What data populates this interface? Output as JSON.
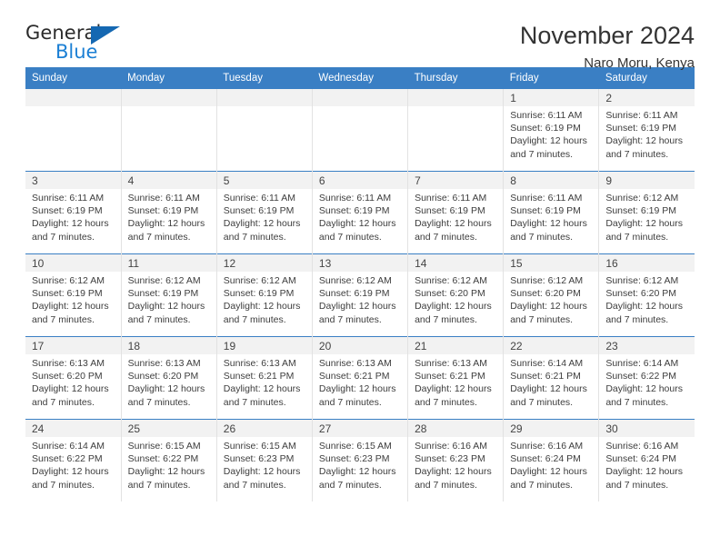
{
  "brand": {
    "name_part1": "General",
    "name_part2": "Blue",
    "accent_color": "#1b7fd4",
    "triangle_color": "#1568b2"
  },
  "header": {
    "title": "November 2024",
    "subtitle": "Naro Moru, Kenya"
  },
  "calendar": {
    "header_bg": "#3a7fc4",
    "daynum_bg": "#f2f2f2",
    "weekday_headers": [
      "Sunday",
      "Monday",
      "Tuesday",
      "Wednesday",
      "Thursday",
      "Friday",
      "Saturday"
    ],
    "labels": {
      "sunrise_prefix": "Sunrise:",
      "sunset_prefix": "Sunset:",
      "daylight_prefix": "Daylight:"
    },
    "weeks": [
      [
        {
          "day": "",
          "sunrise": "",
          "sunset": "",
          "daylight_line1": "",
          "daylight_line2": ""
        },
        {
          "day": "",
          "sunrise": "",
          "sunset": "",
          "daylight_line1": "",
          "daylight_line2": ""
        },
        {
          "day": "",
          "sunrise": "",
          "sunset": "",
          "daylight_line1": "",
          "daylight_line2": ""
        },
        {
          "day": "",
          "sunrise": "",
          "sunset": "",
          "daylight_line1": "",
          "daylight_line2": ""
        },
        {
          "day": "",
          "sunrise": "",
          "sunset": "",
          "daylight_line1": "",
          "daylight_line2": ""
        },
        {
          "day": "1",
          "sunrise": "Sunrise: 6:11 AM",
          "sunset": "Sunset: 6:19 PM",
          "daylight_line1": "Daylight: 12 hours",
          "daylight_line2": "and 7 minutes."
        },
        {
          "day": "2",
          "sunrise": "Sunrise: 6:11 AM",
          "sunset": "Sunset: 6:19 PM",
          "daylight_line1": "Daylight: 12 hours",
          "daylight_line2": "and 7 minutes."
        }
      ],
      [
        {
          "day": "3",
          "sunrise": "Sunrise: 6:11 AM",
          "sunset": "Sunset: 6:19 PM",
          "daylight_line1": "Daylight: 12 hours",
          "daylight_line2": "and 7 minutes."
        },
        {
          "day": "4",
          "sunrise": "Sunrise: 6:11 AM",
          "sunset": "Sunset: 6:19 PM",
          "daylight_line1": "Daylight: 12 hours",
          "daylight_line2": "and 7 minutes."
        },
        {
          "day": "5",
          "sunrise": "Sunrise: 6:11 AM",
          "sunset": "Sunset: 6:19 PM",
          "daylight_line1": "Daylight: 12 hours",
          "daylight_line2": "and 7 minutes."
        },
        {
          "day": "6",
          "sunrise": "Sunrise: 6:11 AM",
          "sunset": "Sunset: 6:19 PM",
          "daylight_line1": "Daylight: 12 hours",
          "daylight_line2": "and 7 minutes."
        },
        {
          "day": "7",
          "sunrise": "Sunrise: 6:11 AM",
          "sunset": "Sunset: 6:19 PM",
          "daylight_line1": "Daylight: 12 hours",
          "daylight_line2": "and 7 minutes."
        },
        {
          "day": "8",
          "sunrise": "Sunrise: 6:11 AM",
          "sunset": "Sunset: 6:19 PM",
          "daylight_line1": "Daylight: 12 hours",
          "daylight_line2": "and 7 minutes."
        },
        {
          "day": "9",
          "sunrise": "Sunrise: 6:12 AM",
          "sunset": "Sunset: 6:19 PM",
          "daylight_line1": "Daylight: 12 hours",
          "daylight_line2": "and 7 minutes."
        }
      ],
      [
        {
          "day": "10",
          "sunrise": "Sunrise: 6:12 AM",
          "sunset": "Sunset: 6:19 PM",
          "daylight_line1": "Daylight: 12 hours",
          "daylight_line2": "and 7 minutes."
        },
        {
          "day": "11",
          "sunrise": "Sunrise: 6:12 AM",
          "sunset": "Sunset: 6:19 PM",
          "daylight_line1": "Daylight: 12 hours",
          "daylight_line2": "and 7 minutes."
        },
        {
          "day": "12",
          "sunrise": "Sunrise: 6:12 AM",
          "sunset": "Sunset: 6:19 PM",
          "daylight_line1": "Daylight: 12 hours",
          "daylight_line2": "and 7 minutes."
        },
        {
          "day": "13",
          "sunrise": "Sunrise: 6:12 AM",
          "sunset": "Sunset: 6:19 PM",
          "daylight_line1": "Daylight: 12 hours",
          "daylight_line2": "and 7 minutes."
        },
        {
          "day": "14",
          "sunrise": "Sunrise: 6:12 AM",
          "sunset": "Sunset: 6:20 PM",
          "daylight_line1": "Daylight: 12 hours",
          "daylight_line2": "and 7 minutes."
        },
        {
          "day": "15",
          "sunrise": "Sunrise: 6:12 AM",
          "sunset": "Sunset: 6:20 PM",
          "daylight_line1": "Daylight: 12 hours",
          "daylight_line2": "and 7 minutes."
        },
        {
          "day": "16",
          "sunrise": "Sunrise: 6:12 AM",
          "sunset": "Sunset: 6:20 PM",
          "daylight_line1": "Daylight: 12 hours",
          "daylight_line2": "and 7 minutes."
        }
      ],
      [
        {
          "day": "17",
          "sunrise": "Sunrise: 6:13 AM",
          "sunset": "Sunset: 6:20 PM",
          "daylight_line1": "Daylight: 12 hours",
          "daylight_line2": "and 7 minutes."
        },
        {
          "day": "18",
          "sunrise": "Sunrise: 6:13 AM",
          "sunset": "Sunset: 6:20 PM",
          "daylight_line1": "Daylight: 12 hours",
          "daylight_line2": "and 7 minutes."
        },
        {
          "day": "19",
          "sunrise": "Sunrise: 6:13 AM",
          "sunset": "Sunset: 6:21 PM",
          "daylight_line1": "Daylight: 12 hours",
          "daylight_line2": "and 7 minutes."
        },
        {
          "day": "20",
          "sunrise": "Sunrise: 6:13 AM",
          "sunset": "Sunset: 6:21 PM",
          "daylight_line1": "Daylight: 12 hours",
          "daylight_line2": "and 7 minutes."
        },
        {
          "day": "21",
          "sunrise": "Sunrise: 6:13 AM",
          "sunset": "Sunset: 6:21 PM",
          "daylight_line1": "Daylight: 12 hours",
          "daylight_line2": "and 7 minutes."
        },
        {
          "day": "22",
          "sunrise": "Sunrise: 6:14 AM",
          "sunset": "Sunset: 6:21 PM",
          "daylight_line1": "Daylight: 12 hours",
          "daylight_line2": "and 7 minutes."
        },
        {
          "day": "23",
          "sunrise": "Sunrise: 6:14 AM",
          "sunset": "Sunset: 6:22 PM",
          "daylight_line1": "Daylight: 12 hours",
          "daylight_line2": "and 7 minutes."
        }
      ],
      [
        {
          "day": "24",
          "sunrise": "Sunrise: 6:14 AM",
          "sunset": "Sunset: 6:22 PM",
          "daylight_line1": "Daylight: 12 hours",
          "daylight_line2": "and 7 minutes."
        },
        {
          "day": "25",
          "sunrise": "Sunrise: 6:15 AM",
          "sunset": "Sunset: 6:22 PM",
          "daylight_line1": "Daylight: 12 hours",
          "daylight_line2": "and 7 minutes."
        },
        {
          "day": "26",
          "sunrise": "Sunrise: 6:15 AM",
          "sunset": "Sunset: 6:23 PM",
          "daylight_line1": "Daylight: 12 hours",
          "daylight_line2": "and 7 minutes."
        },
        {
          "day": "27",
          "sunrise": "Sunrise: 6:15 AM",
          "sunset": "Sunset: 6:23 PM",
          "daylight_line1": "Daylight: 12 hours",
          "daylight_line2": "and 7 minutes."
        },
        {
          "day": "28",
          "sunrise": "Sunrise: 6:16 AM",
          "sunset": "Sunset: 6:23 PM",
          "daylight_line1": "Daylight: 12 hours",
          "daylight_line2": "and 7 minutes."
        },
        {
          "day": "29",
          "sunrise": "Sunrise: 6:16 AM",
          "sunset": "Sunset: 6:24 PM",
          "daylight_line1": "Daylight: 12 hours",
          "daylight_line2": "and 7 minutes."
        },
        {
          "day": "30",
          "sunrise": "Sunrise: 6:16 AM",
          "sunset": "Sunset: 6:24 PM",
          "daylight_line1": "Daylight: 12 hours",
          "daylight_line2": "and 7 minutes."
        }
      ]
    ]
  }
}
